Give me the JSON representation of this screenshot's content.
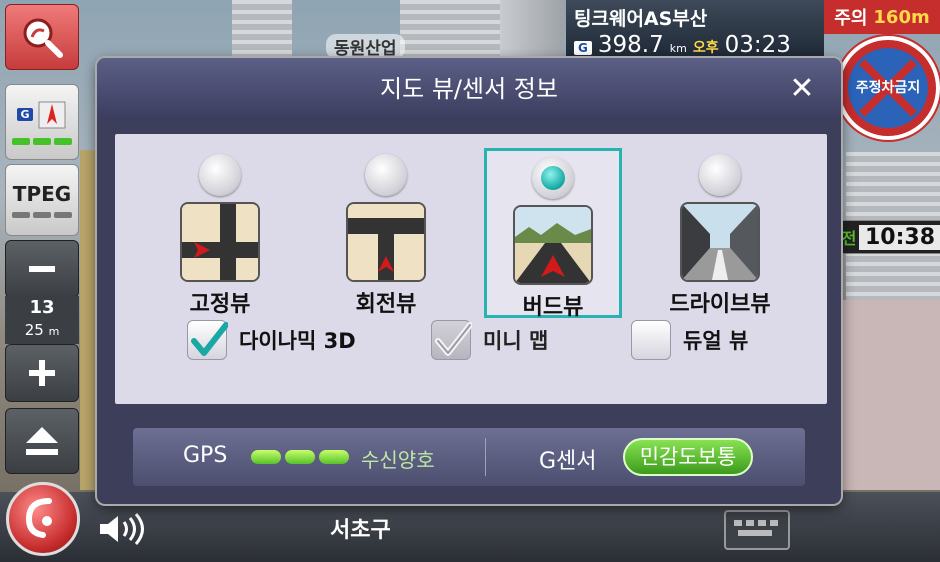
{
  "map": {
    "poi_label": "동원산업",
    "district": "서초구"
  },
  "toolbar": {
    "gps_letter": "G",
    "tpeg_label": "TPEG",
    "scale_level": "13",
    "scale_distance": "25",
    "scale_unit": "m"
  },
  "route": {
    "destination": "팅크웨어AS부산",
    "gps_letter": "G",
    "distance": "398.7",
    "distance_unit": "km",
    "ampm": "오후",
    "arrival_time": "03:23"
  },
  "alert": {
    "caution_label": "주의",
    "caution_distance": "160m",
    "sign_text": "주정차금지"
  },
  "clock": {
    "prefix": "전",
    "time": "10:38"
  },
  "dialog": {
    "title": "지도 뷰/센서 정보",
    "close_glyph": "✕",
    "views": [
      {
        "label": "고정뷰",
        "selected": false
      },
      {
        "label": "회전뷰",
        "selected": false
      },
      {
        "label": "버드뷰",
        "selected": true
      },
      {
        "label": "드라이브뷰",
        "selected": false
      }
    ],
    "options": [
      {
        "label": "다이나믹 3D",
        "checked": true,
        "enabled": true
      },
      {
        "label": "미니 맵",
        "checked": true,
        "enabled": false
      },
      {
        "label": "듀얼 뷰",
        "checked": false,
        "enabled": true
      }
    ],
    "status": {
      "gps_label": "GPS",
      "gps_signal_bars": 3,
      "gps_status": "수신양호",
      "sensor_label": "G센서",
      "sensor_value": "민감도보통"
    }
  },
  "colors": {
    "accent": "#27b3b0",
    "dialog_bg": "#3d3f5a",
    "panel_bg": "#dcd9e8",
    "caution_red": "#c62d2d",
    "sensor_green": "#57c22a"
  }
}
